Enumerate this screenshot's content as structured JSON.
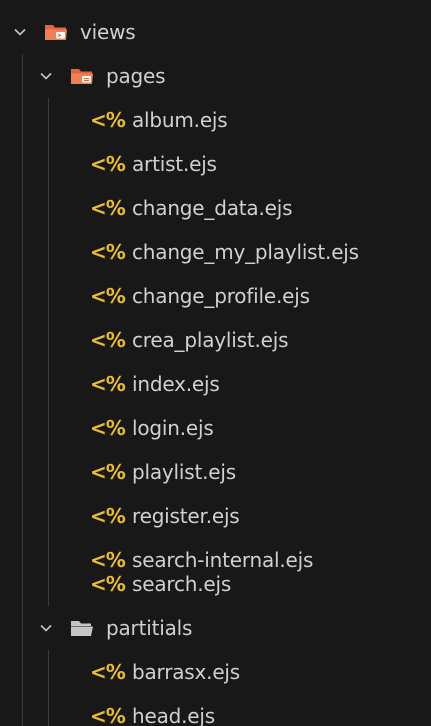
{
  "tree": {
    "folder_views": {
      "label": "views",
      "expanded": true,
      "icon": "views-folder-icon"
    },
    "folder_pages": {
      "label": "pages",
      "expanded": true,
      "icon": "pages-folder-icon"
    },
    "pages_files": [
      "album.ejs",
      "artist.ejs",
      "change_data.ejs",
      "change_my_playlist.ejs",
      "change_profile.ejs",
      "crea_playlist.ejs",
      "index.ejs",
      "login.ejs",
      "playlist.ejs",
      "register.ejs",
      "search-internal.ejs",
      "search.ejs"
    ],
    "folder_partitials": {
      "label": "partitials",
      "expanded": true,
      "icon": "folder-open-icon"
    },
    "partitials_files": [
      "barrasx.ejs",
      "head.ejs"
    ],
    "file_icon_glyph": "<%",
    "colors": {
      "background": "#181818",
      "text": "#d0d0d0",
      "ejs_icon": "#e8bf2a",
      "special_folder": "#e8643c",
      "plain_folder": "#c5c5c5"
    }
  }
}
